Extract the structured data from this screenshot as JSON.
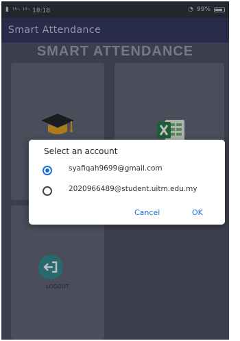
{
  "statusbar": {
    "left_text": "¹⁵⸌ ¹⁵⸌ 18:18",
    "right_text": "99%"
  },
  "appbar": {
    "title": "Smart Attendance"
  },
  "main": {
    "heading": "SMART ATTENDANCE",
    "tiles": [
      {
        "icon": "graduation-cap-icon"
      },
      {
        "icon": "excel-icon"
      },
      {
        "icon": "logout-icon",
        "label": "LOGOUT"
      }
    ]
  },
  "dialog": {
    "title": "Select an account",
    "options": [
      {
        "label": "syafiqah9699@gmail.com",
        "selected": true
      },
      {
        "label": "2020966489@student.uitm.edu.my",
        "selected": false
      }
    ],
    "cancel_label": "Cancel",
    "ok_label": "OK"
  },
  "colors": {
    "appbar": "#30335a",
    "background": "#4a5060",
    "tile": "#5f6474",
    "accent": "#1e6fd9",
    "logout": "#2e8a8e"
  }
}
